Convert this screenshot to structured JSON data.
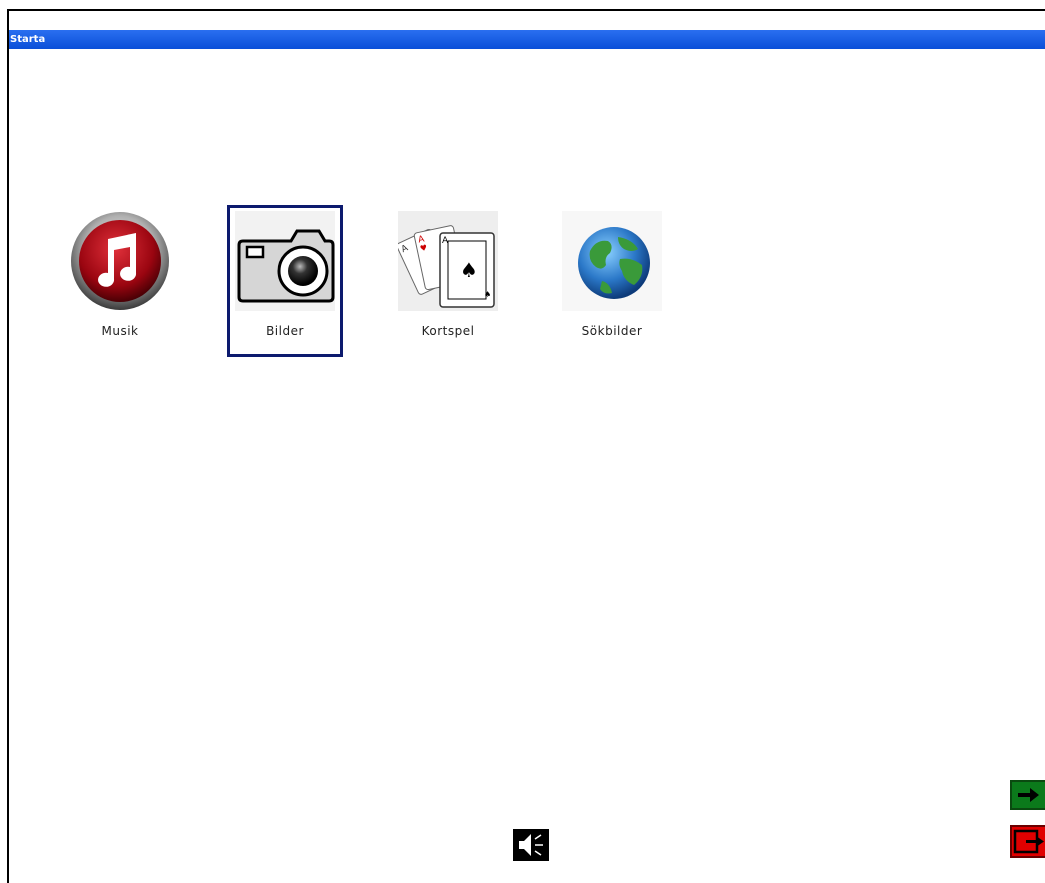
{
  "window": {
    "title": "Starta"
  },
  "apps": [
    {
      "label": "Musik",
      "icon": "music-note-icon",
      "selected": false
    },
    {
      "label": "Bilder",
      "icon": "camera-icon",
      "selected": true
    },
    {
      "label": "Kortspel",
      "icon": "playing-cards-icon",
      "selected": false
    },
    {
      "label": "Sökbilder",
      "icon": "globe-icon",
      "selected": false
    }
  ],
  "controls": {
    "sound": {
      "icon": "speaker-icon"
    },
    "next": {
      "icon": "arrow-right-icon",
      "color": "#0b7a1b"
    },
    "exit": {
      "icon": "exit-icon",
      "color": "#e00000"
    }
  },
  "colors": {
    "titlebar": "#0a4fd8",
    "selection": "#0c1a6e"
  }
}
